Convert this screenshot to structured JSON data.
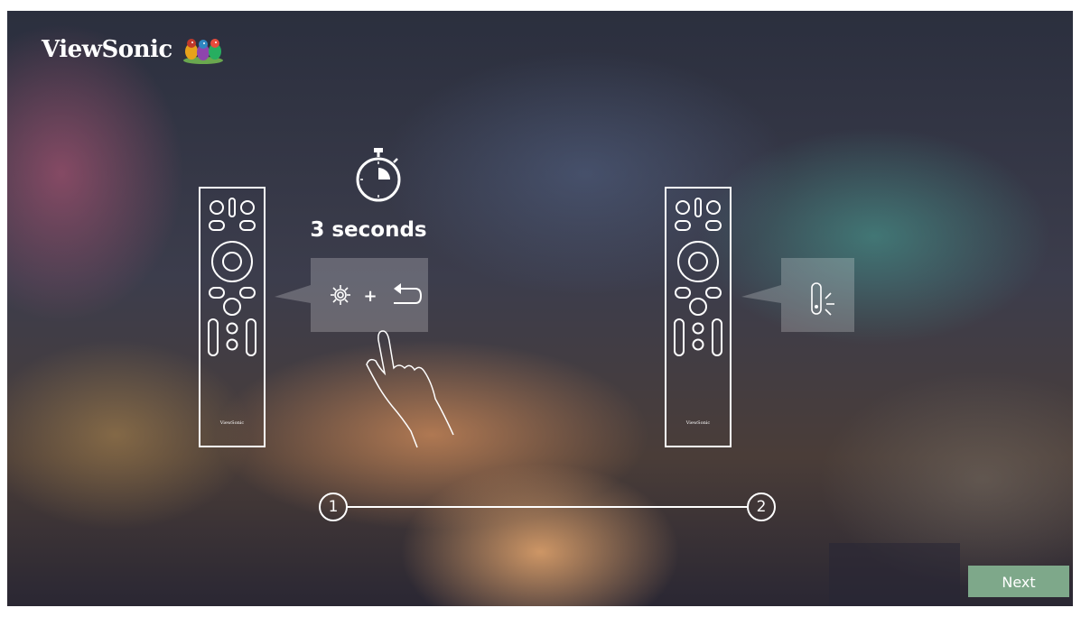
{
  "brand": {
    "logo_text": "ViewSonic",
    "trademark": "®"
  },
  "step1": {
    "duration_label": "3 seconds",
    "remote_brand": "ViewSonic",
    "combo_plus": "+",
    "step_number": "1"
  },
  "step2": {
    "remote_brand": "ViewSonic",
    "step_number": "2"
  },
  "actions": {
    "next_label": "Next"
  },
  "colors": {
    "next_button_bg": "#7ea88a",
    "line_art": "#ffffff"
  },
  "icons": [
    "stopwatch-icon",
    "settings-gear-icon",
    "back-arrow-icon",
    "blinking-led-icon",
    "pointing-hand-icon"
  ]
}
